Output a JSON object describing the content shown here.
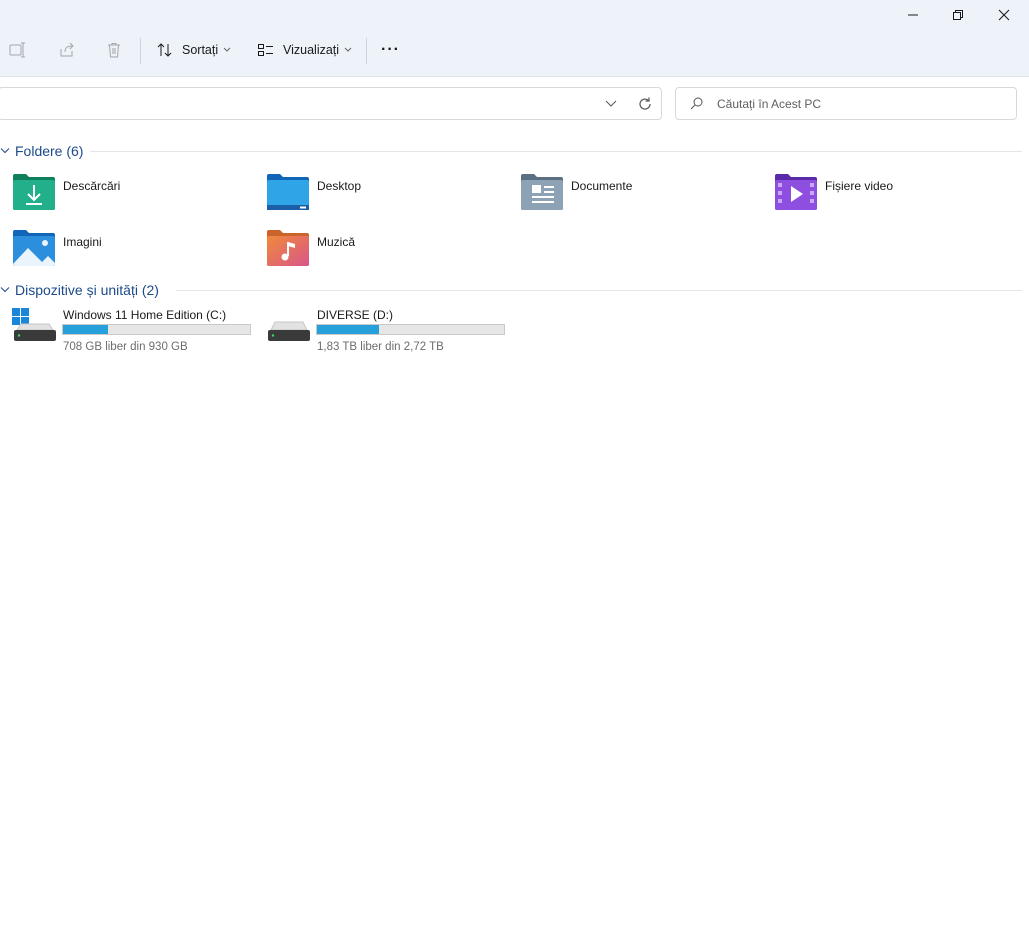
{
  "toolbar": {
    "sort_label": "Sortați",
    "view_label": "Vizualizați",
    "more_label": "···"
  },
  "search": {
    "placeholder": "Căutați în Acest PC"
  },
  "folders": {
    "title": "Foldere (6)",
    "items": [
      {
        "label": "Descărcări",
        "icon": "downloads-folder-icon"
      },
      {
        "label": "Desktop",
        "icon": "desktop-folder-icon"
      },
      {
        "label": "Documente",
        "icon": "documents-folder-icon"
      },
      {
        "label": "Fișiere video",
        "icon": "videos-folder-icon"
      },
      {
        "label": "Imagini",
        "icon": "pictures-folder-icon"
      },
      {
        "label": "Muzică",
        "icon": "music-folder-icon"
      }
    ]
  },
  "devices": {
    "title": "Dispozitive și unități (2)",
    "items": [
      {
        "name": "Windows 11 Home Edition (C:)",
        "free_text": "708 GB liber din 930 GB",
        "used_fraction": 0.24
      },
      {
        "name": "DIVERSE (D:)",
        "free_text": "1,83 TB liber din 2,72 TB",
        "used_fraction": 0.33
      }
    ]
  },
  "colors": {
    "accent": "#26a0da",
    "section_title": "#1c4a8a",
    "titlebar_bg": "#eef3f9"
  }
}
